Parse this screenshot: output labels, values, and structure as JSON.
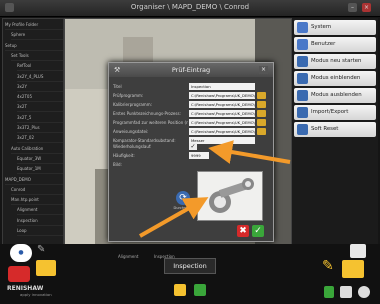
{
  "window": {
    "title": "Organiser \\ MAPD_DEMO \\ Conrod"
  },
  "tree": {
    "items": [
      {
        "label": "My Profile Folder",
        "indent": 0
      },
      {
        "label": "Sphere",
        "indent": 1
      },
      {
        "label": "Setup",
        "indent": 0
      },
      {
        "label": "Set Tools",
        "indent": 1
      },
      {
        "label": "RefTool",
        "indent": 2
      },
      {
        "label": "3x2Y_4_PLUS",
        "indent": 2
      },
      {
        "label": "3x2Y",
        "indent": 2
      },
      {
        "label": "4x2T05",
        "indent": 2
      },
      {
        "label": "3x2T",
        "indent": 2
      },
      {
        "label": "3x2T_5",
        "indent": 2
      },
      {
        "label": "3x3T2_Plus",
        "indent": 2
      },
      {
        "label": "3x2T_02",
        "indent": 2
      },
      {
        "label": "Auto Calibration",
        "indent": 1
      },
      {
        "label": "Equator_3W",
        "indent": 2
      },
      {
        "label": "Equator_1M",
        "indent": 2
      },
      {
        "label": "MAPD_DEMO",
        "indent": 0
      },
      {
        "label": "Conrod",
        "indent": 1
      },
      {
        "label": "Man.htp.point",
        "indent": 1
      },
      {
        "label": "Alignment",
        "indent": 2
      },
      {
        "label": "Inspection",
        "indent": 2
      },
      {
        "label": "Loop",
        "indent": 2
      }
    ]
  },
  "sidebar": {
    "buttons": [
      {
        "label": "System",
        "color": "#4a78c8"
      },
      {
        "label": "Benutzer",
        "color": "#4a78c8"
      },
      {
        "label": "Modus neu starten",
        "color": "#3a6ab0"
      },
      {
        "label": "Modus einblenden",
        "color": "#3a6ab0"
      },
      {
        "label": "Modus ausblenden",
        "color": "#3a6ab0"
      },
      {
        "label": "Import/Export",
        "color": "#3a6ab0"
      },
      {
        "label": "Soft Reset",
        "color": "#3a6ab0"
      }
    ]
  },
  "dialog": {
    "title": "Prüf-Eintrag",
    "fields": [
      {
        "label": "Titel",
        "value": "Inspection",
        "open": false
      },
      {
        "label": "Prüfprogramm:",
        "value": "C:\\Renishaw\\Programs\\UK_DEMO\\Con Ro",
        "open": true
      },
      {
        "label": "Kalibrierprogramm:",
        "value": "C:\\Renishaw\\Programs\\UK_DEMO\\Con Ro",
        "open": true
      },
      {
        "label": "Erstes Punktezeichnungs-Prozess:",
        "value": "C:\\Renishaw\\Programs\\UK_DEMO\\Con Rod\\",
        "open": true
      },
      {
        "label": "Programmfad zur weiteren Position (nur beim Sen):",
        "value": "C:\\Renishaw\\Programs\\UK_DEMO\\Con Rod\\",
        "open": true
      },
      {
        "label": "Anweisungsdatei:",
        "value": "C:\\Renishaw\\Programs\\UK_DEMO\\images",
        "open": true
      },
      {
        "label": "Komparator-Standardsubstand:",
        "value": "Messer",
        "open": false
      }
    ],
    "repeat_label": "Wiederholungslauf:",
    "repeat_checked": true,
    "count_label": "Häufigkeit:",
    "count_value": "9999",
    "image_label": "Bild:",
    "browse_label": "Durchsuchen",
    "cancel_icon": "close-icon",
    "ok_icon": "check-icon"
  },
  "bottom": {
    "tab_label": "Inspection",
    "brand": "RENISHAW",
    "brand_tagline": "apply innovation",
    "status_left": "Alignment",
    "status_mid": "Inspection"
  },
  "colors": {
    "accent": "#f39a2a",
    "cancel": "#d62a2a",
    "ok": "#3aa63a"
  }
}
